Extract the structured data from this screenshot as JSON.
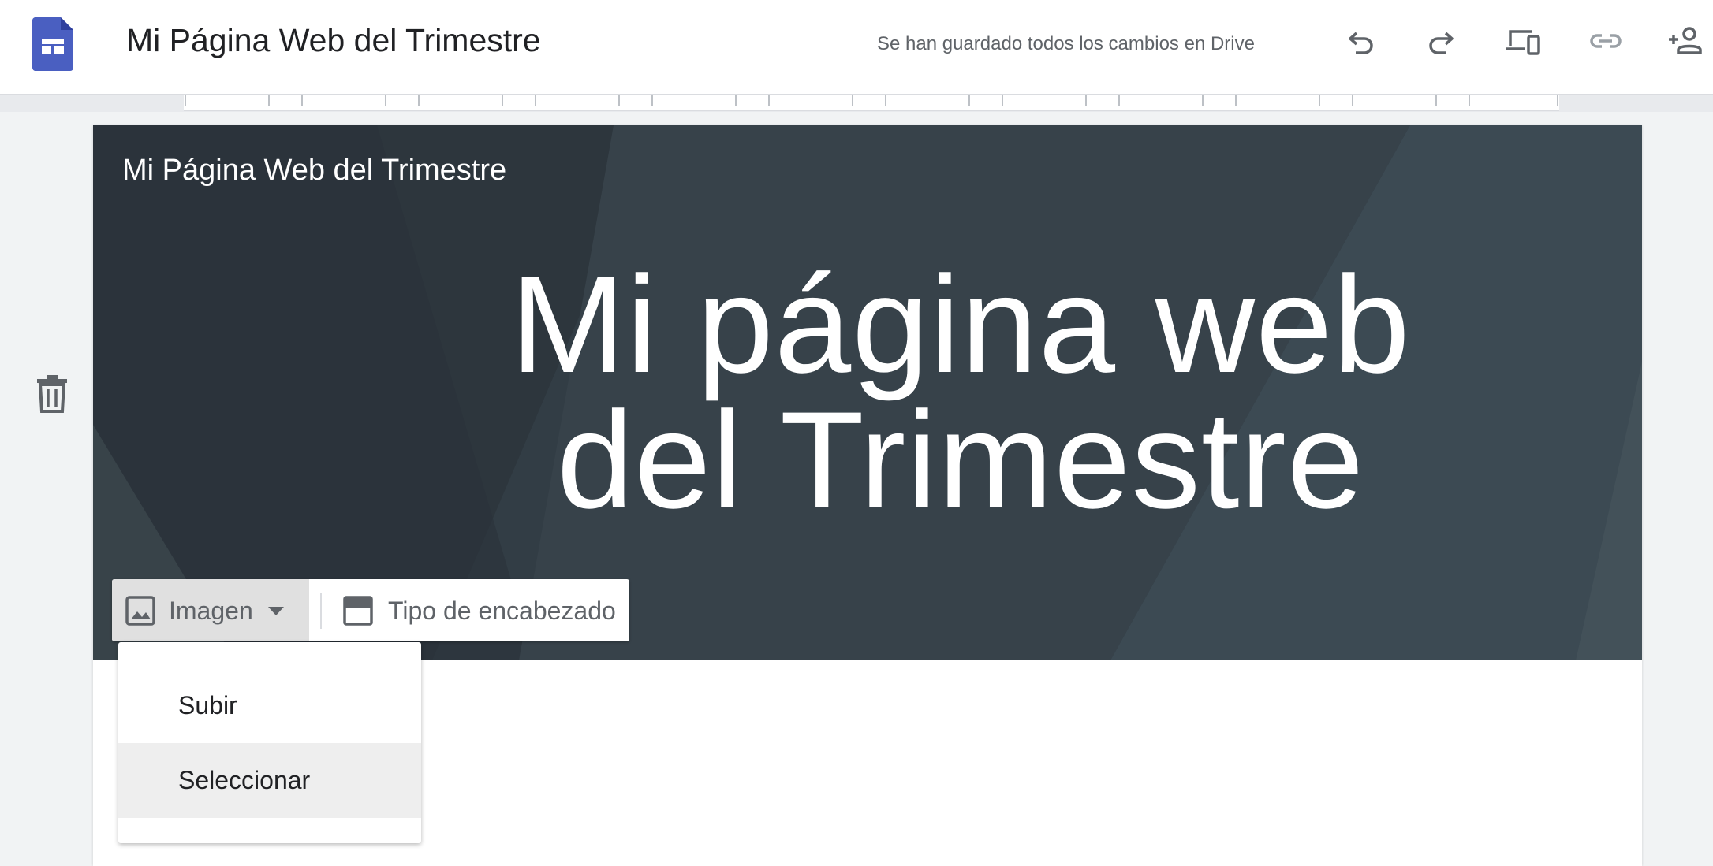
{
  "header": {
    "title": "Mi Página Web del Trimestre",
    "save_status": "Se han guardado todos los cambios en Drive",
    "icons": [
      "undo-icon",
      "redo-icon",
      "preview-devices-icon",
      "link-icon",
      "share-icon"
    ]
  },
  "hero": {
    "site_name": "Mi Página Web del Trimestre",
    "title_line1": "Mi página web",
    "title_line2": "del Trimestre"
  },
  "hero_toolbar": {
    "image_label": "Imagen",
    "header_type_label": "Tipo de encabezado"
  },
  "image_menu": {
    "items": [
      {
        "label": "Subir"
      },
      {
        "label": "Seleccionar",
        "highlighted": true
      }
    ]
  },
  "colors": {
    "brand": "#4a5fc1",
    "hero_background": "#2f3a41",
    "menu_highlight": "#eeeeee"
  }
}
